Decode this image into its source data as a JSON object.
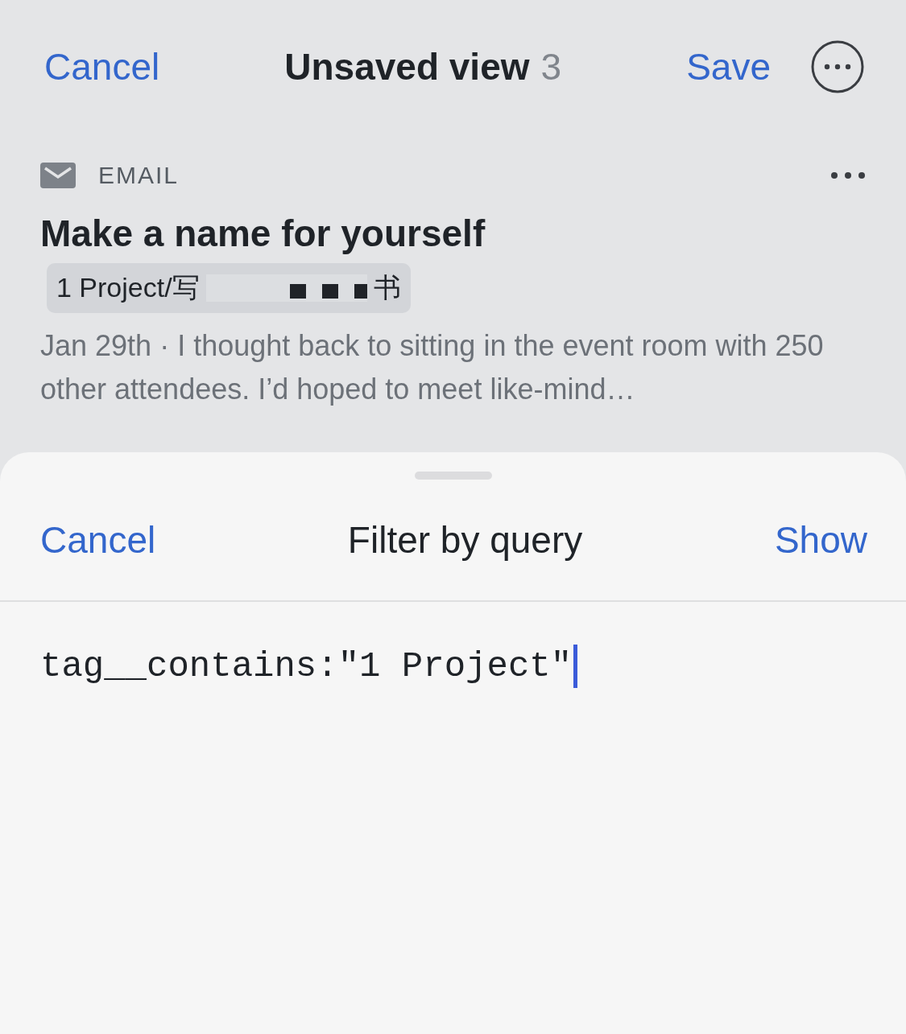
{
  "nav_bar": {
    "cancel": "Cancel",
    "title": "Unsaved view",
    "count": "3",
    "save": "Save"
  },
  "item": {
    "type": "EMAIL",
    "title": "Make a name for yourself",
    "tag": {
      "text_start": "1 Project/写",
      "text_end": "书"
    },
    "date": "Jan 29th",
    "separator": "·",
    "snippet": "I thought back to sitting in the event room with 250 other attendees. I’d hoped to meet like-mind…"
  },
  "sheet": {
    "cancel": "Cancel",
    "title": "Filter by query",
    "show": "Show",
    "query": "tag__contains:\"1 Project\""
  }
}
